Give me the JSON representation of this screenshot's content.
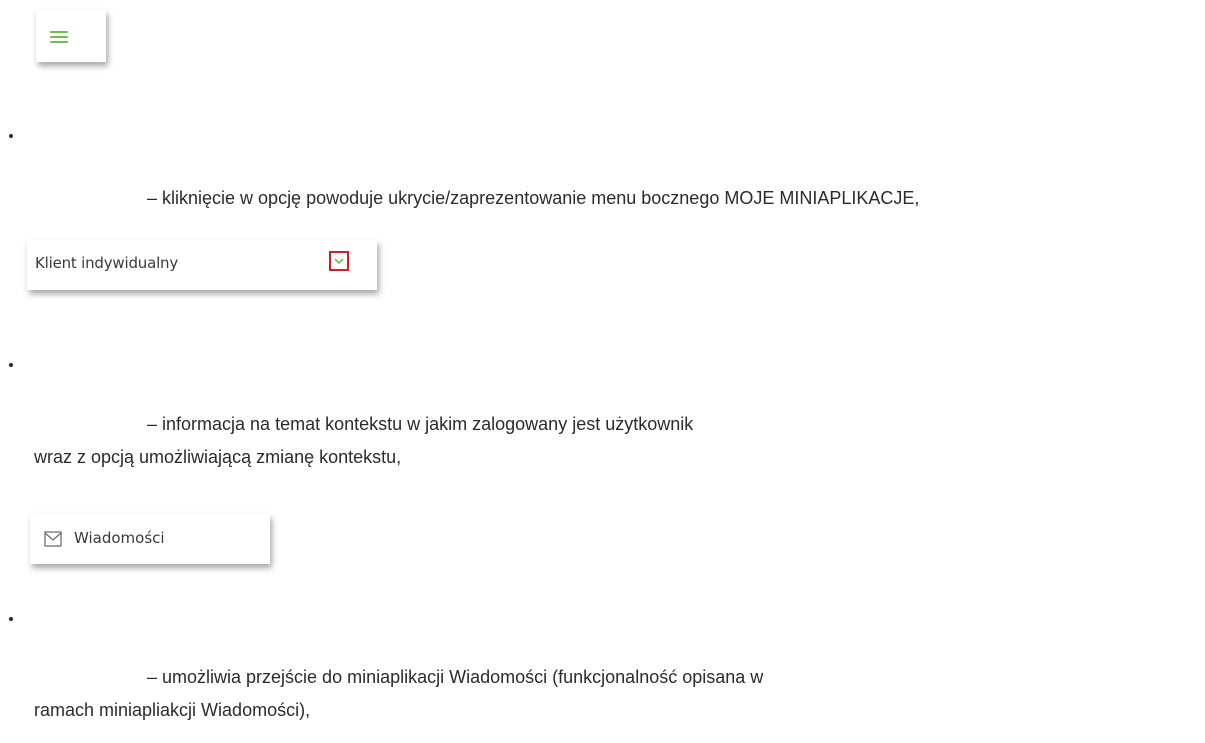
{
  "items": [
    {
      "icon": "hamburger-menu-icon",
      "description": "– kliknięcie w opcję powoduje ukrycie/zaprezentowanie menu bocznego MOJE MINIAPLIKACJE,"
    },
    {
      "widget_label": "Klient indywidualny",
      "icon": "chevron-down-icon",
      "description_line1": "– informacja na temat kontekstu w jakim zalogowany jest użytkownik",
      "description_line2": "wraz z opcją umożliwiającą zmianę kontekstu,"
    },
    {
      "widget_label": "Wiadomości",
      "icon": "envelope-icon",
      "description_line1": "– umożliwia przejście do miniaplikacji Wiadomości (funkcjonalność opisana w",
      "description_line2": "ramach miniapliakcji Wiadomości),"
    }
  ],
  "colors": {
    "accent_green": "#6fbf4f",
    "highlight_red": "#cf1f2e"
  }
}
